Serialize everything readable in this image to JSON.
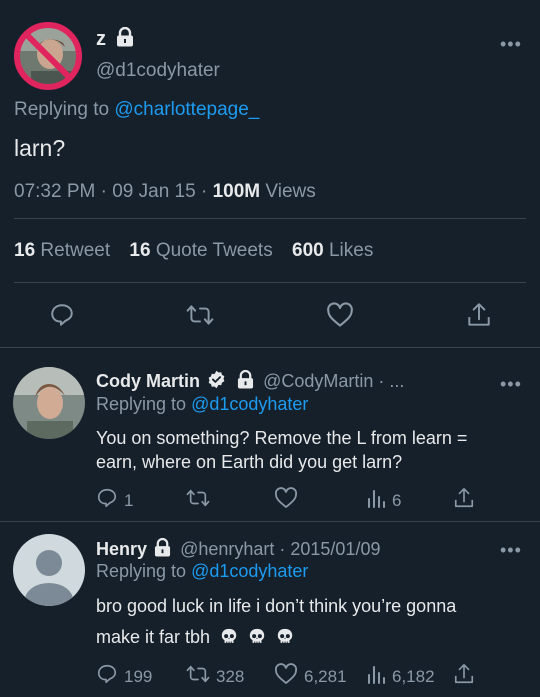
{
  "main_tweet": {
    "display_name": "z",
    "handle": "@d1codyhater",
    "replying_prefix": "Replying to",
    "replying_to": "@charlottepage_",
    "text": "larn?",
    "time": "07:32 PM",
    "date": "09 Jan 15",
    "views_count": "100M",
    "views_label": "Views",
    "sep": "·",
    "stats": {
      "retweets_count": "16",
      "retweets_label": "Retweet",
      "quotes_count": "16",
      "quotes_label": "Quote Tweets",
      "likes_count": "600",
      "likes_label": "Likes"
    },
    "more": "•••"
  },
  "replies": [
    {
      "display_name": "Cody Martin",
      "handle": "@CodyMartin · ...",
      "replying_prefix": "Replying to",
      "replying_to": "@d1codyhater",
      "text_line1": "You on something? Remove the L from learn =",
      "text_line2": "earn, where on Earth did you get larn?",
      "replies_count": "1",
      "retweets_count": "",
      "likes_count": "",
      "views_count": "6",
      "more": "•••"
    },
    {
      "display_name": "Henry",
      "handle": "@henryhart · 2015/01/09",
      "replying_prefix": "Replying to",
      "replying_to": "@d1codyhater",
      "text_line1": "bro good luck in life i don’t think you’re gonna",
      "text_line2": "make it far tbh",
      "replies_count": "199",
      "retweets_count": "328",
      "likes_count": "6,281",
      "views_count": "6,182",
      "more": "•••"
    }
  ],
  "colors": {
    "background": "#15202b",
    "accent": "#1d9bf0",
    "muted": "#8b98a5",
    "verified": "#e7e9ea",
    "no_sign": "#e0245e"
  }
}
